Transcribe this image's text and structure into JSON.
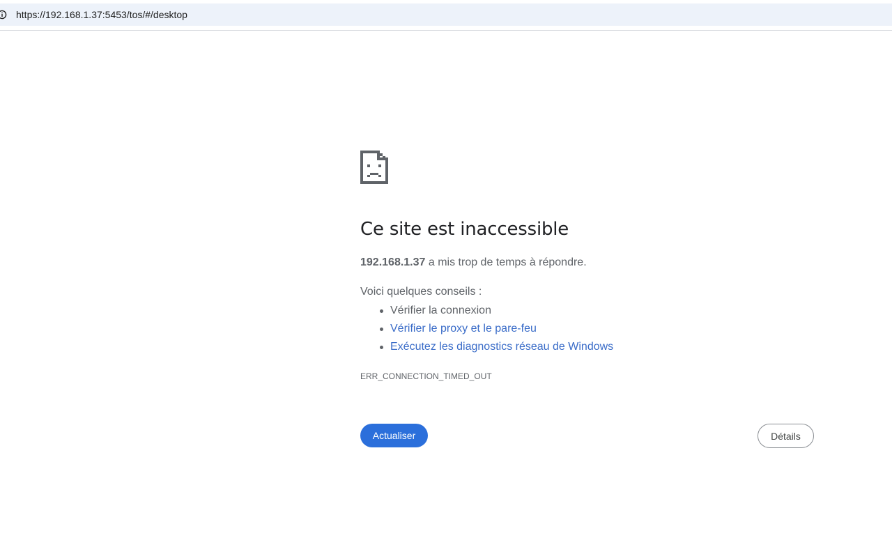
{
  "addressbar": {
    "icon": "info-icon",
    "url": "https://192.168.1.37:5453/tos/#/desktop"
  },
  "error_page": {
    "icon": "sad-page-icon",
    "title": "Ce site est inaccessible",
    "host": "192.168.1.37",
    "summary_rest": " a mis trop de temps à répondre.",
    "suggestions_heading": "Voici quelques conseils :",
    "suggestions": [
      {
        "label": "Vérifier la connexion",
        "is_link": false
      },
      {
        "label": "Vérifier le proxy et le pare-feu",
        "is_link": true
      },
      {
        "label": "Exécutez les diagnostics réseau de Windows",
        "is_link": true
      }
    ],
    "error_code": "ERR_CONNECTION_TIMED_OUT",
    "reload_label": "Actualiser",
    "details_label": "Détails"
  },
  "colors": {
    "addressbar_bg": "#edf2fa",
    "primary_button": "#2b6fdb",
    "link": "#3a6cc8",
    "text_secondary": "#5f6368"
  }
}
